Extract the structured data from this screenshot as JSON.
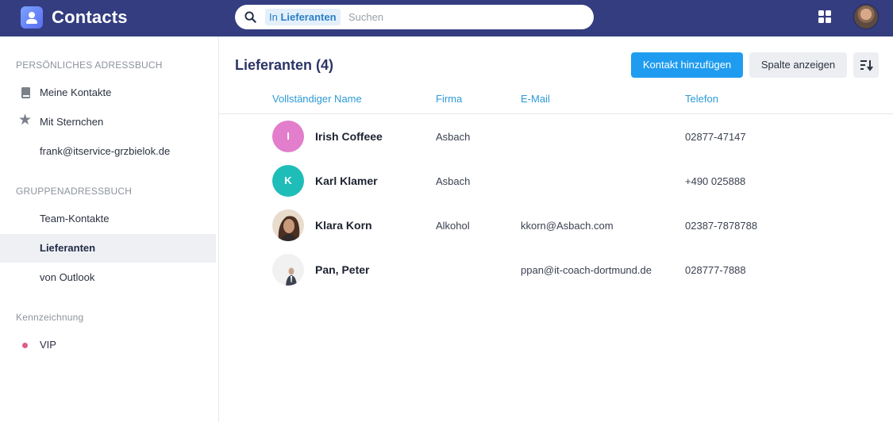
{
  "app": {
    "title": "Contacts"
  },
  "search": {
    "scope_prefix": "In",
    "scope_name": "Lieferanten",
    "placeholder": "Suchen"
  },
  "sidebar": {
    "personal_header": "PERSÖNLICHES ADRESSBUCH",
    "personal_items": [
      {
        "label": "Meine Kontakte",
        "icon": "book-icon"
      },
      {
        "label": "Mit Sternchen",
        "icon": "star-icon"
      },
      {
        "label": "frank@itservice-grzbielok.de",
        "icon": ""
      }
    ],
    "group_header": "GRUPPENADRESSBUCH",
    "group_items": [
      {
        "label": "Team-Kontakte"
      },
      {
        "label": "Lieferanten",
        "active": true
      },
      {
        "label": "von Outlook"
      }
    ],
    "tags_header": "Kennzeichnung",
    "tag_items": [
      {
        "label": "VIP",
        "color": "#e05a8c"
      }
    ]
  },
  "main": {
    "title": "Lieferanten (4)",
    "add_button": "Kontakt hinzufügen",
    "columns_button": "Spalte anzeigen",
    "sort_icon": "sort-icon",
    "columns": [
      "Vollständiger Name",
      "Firma",
      "E-Mail",
      "Telefon"
    ],
    "rows": [
      {
        "initial": "I",
        "avatar_color": "#e27ecb",
        "name": "Irish Coffeee",
        "company": "Asbach",
        "email": "",
        "phone": "02877-47147"
      },
      {
        "initial": "K",
        "avatar_color": "#1fbdb8",
        "name": "Karl Klamer",
        "company": "Asbach",
        "email": "",
        "phone": "+490 025888"
      },
      {
        "initial": "",
        "avatar_color": "#6b4a3a",
        "name": "Klara Korn",
        "company": "Alkohol",
        "email": "kkorn@Asbach.com",
        "phone": "02387-7878788"
      },
      {
        "initial": "",
        "avatar_color": "#e9e9ea",
        "name": "Pan, Peter",
        "company": "",
        "email": "ppan@it-coach-dortmund.de",
        "phone": "028777-7888"
      }
    ]
  },
  "colors": {
    "topbar": "#333d80",
    "accent": "#1f9cf0",
    "header_text": "#2c9ad8"
  }
}
